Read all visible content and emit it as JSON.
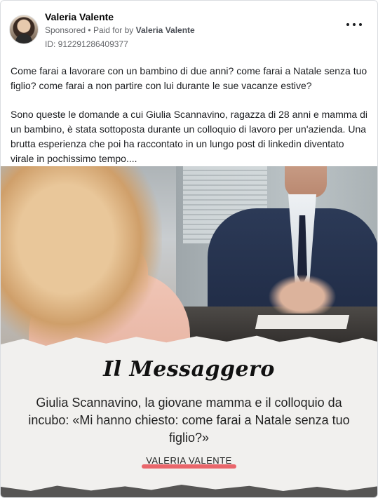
{
  "post": {
    "author": "Valeria Valente",
    "sponsored_label": "Sponsored",
    "paid_for_prefix": "Paid for by",
    "paid_for_name": "Valeria Valente",
    "ad_id": "ID: 912291286409377",
    "more_icon": "more-horizontal-icon",
    "paragraph_1": "Come farai a lavorare con un bambino di due anni? come farai a Natale senza tuo figlio? come farai a non partire con lui durante le sue vacanze estive?",
    "paragraph_2": "Sono queste le domande a cui Giulia Scannavino, ragazza di 28 anni e mamma di un bambino, è stata sottoposta durante un colloquio di lavoro per un'azienda. Una brutta esperienza che poi ha raccontato in un lungo post di linkedin diventato virale in pochissimo tempo...."
  },
  "creative": {
    "masthead": "Il Messaggero",
    "headline": "Giulia Scannavino, la giovane mamma e il colloquio da incubo: «Mi hanno chiesto: come farai a Natale senza tuo figlio?»",
    "byline": "VALERIA VALENTE",
    "accent_color": "#e84d54"
  }
}
